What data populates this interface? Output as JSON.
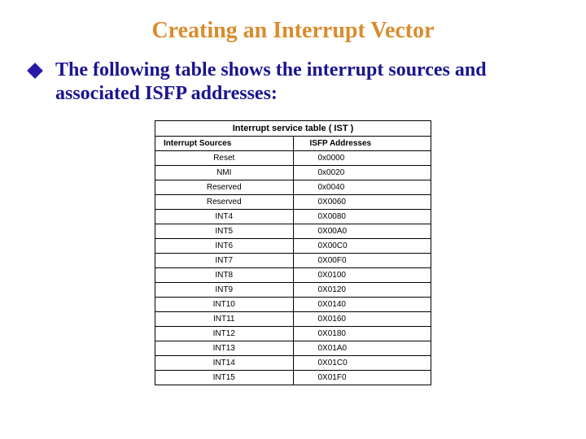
{
  "title": "Creating an Interrupt Vector",
  "body_text": "The following table shows the interrupt sources and associated ISFP addresses:",
  "chart_data": {
    "type": "table",
    "title": "Interrupt service table ( IST )",
    "columns": [
      "Interrupt Sources",
      "ISFP Addresses"
    ],
    "rows": [
      [
        "Reset",
        "0x0000"
      ],
      [
        "NMI",
        "0x0020"
      ],
      [
        "Reserved",
        "0x0040"
      ],
      [
        "Reserved",
        "0X0060"
      ],
      [
        "INT4",
        "0X0080"
      ],
      [
        "INT5",
        "0X00A0"
      ],
      [
        "INT6",
        "0X00C0"
      ],
      [
        "INT7",
        "0X00F0"
      ],
      [
        "INT8",
        "0X0100"
      ],
      [
        "INT9",
        "0X0120"
      ],
      [
        "INT10",
        "0X0140"
      ],
      [
        "INT11",
        "0X0160"
      ],
      [
        "INT12",
        "0X0180"
      ],
      [
        "INT13",
        "0X01A0"
      ],
      [
        "INT14",
        "0X01C0"
      ],
      [
        "INT15",
        "0X01F0"
      ]
    ]
  }
}
